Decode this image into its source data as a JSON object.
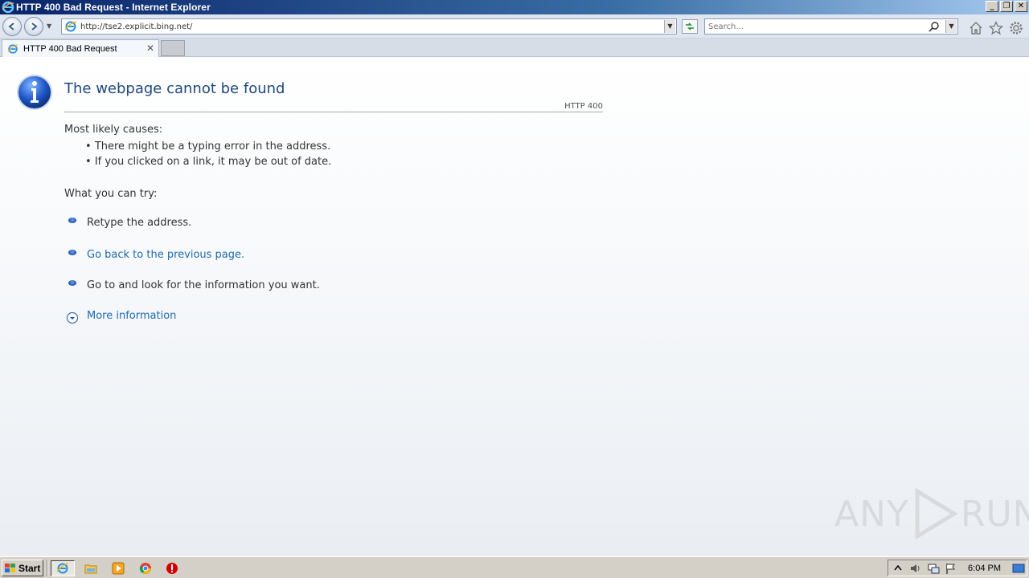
{
  "window": {
    "title": "HTTP 400 Bad Request - Internet Explorer"
  },
  "navbar": {
    "address": "http://tse2.explicit.bing.net/",
    "search_placeholder": "Search..."
  },
  "tabs": [
    {
      "label": "HTTP 400 Bad Request"
    }
  ],
  "page": {
    "heading": "The webpage cannot be found",
    "code": "HTTP 400",
    "causes_title": "Most likely causes:",
    "causes": [
      "There might be a typing error in the address.",
      "If you clicked on a link, it may be out of date."
    ],
    "try_title": "What you can try:",
    "try_items": [
      "Retype the address.",
      "Go back to the previous page.",
      "Go to  and look for the information you want."
    ],
    "more_info": "More information"
  },
  "watermark": {
    "left": "ANY",
    "right": "RUN"
  },
  "taskbar": {
    "start_label": "Start",
    "clock": "6:04 PM"
  },
  "colors": {
    "heading": "#1f497d",
    "link": "#1f6ab0",
    "titlebar_start": "#0a246a",
    "taskbar": "#d4d0c8"
  }
}
